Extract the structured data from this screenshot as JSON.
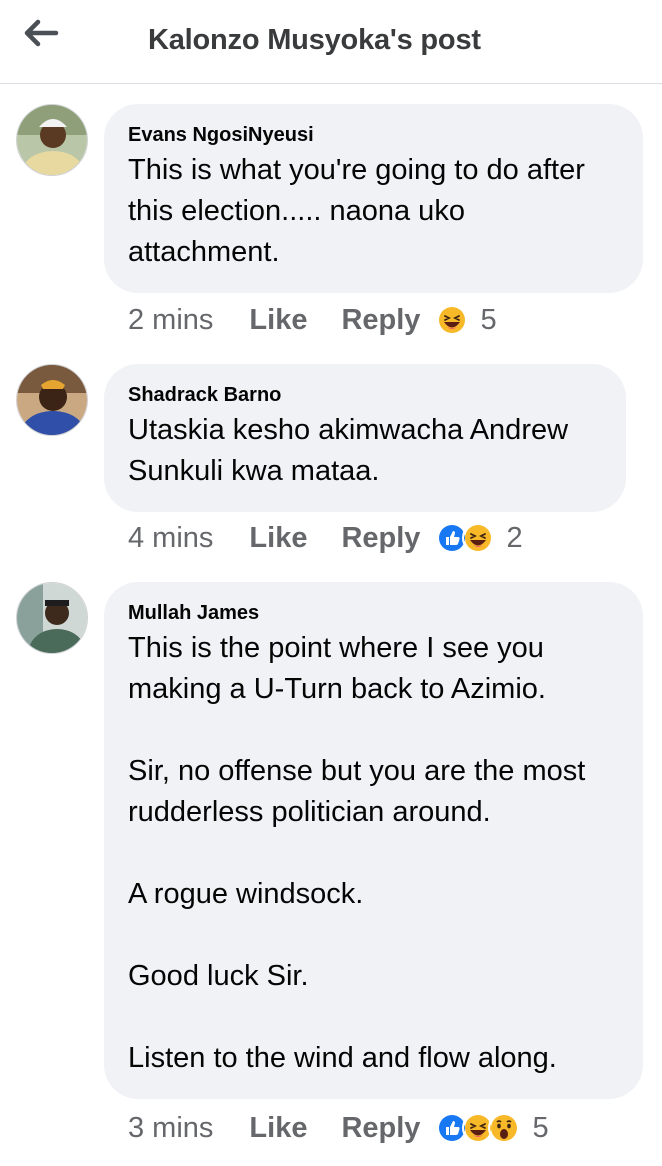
{
  "header": {
    "title": "Kalonzo Musyoka's post",
    "back_icon": "arrow-left-icon"
  },
  "comments": [
    {
      "author": "Evans NgosiNyeusi",
      "text": "This is what you're going to do after this election..... naona uko attachment.",
      "time": "2 mins",
      "like_label": "Like",
      "reply_label": "Reply",
      "reactions": [
        "haha-icon"
      ],
      "reaction_count": "5"
    },
    {
      "author": "Shadrack Barno",
      "text": "Utaskia kesho akimwacha Andrew Sunkuli kwa mataa.",
      "time": "4 mins",
      "like_label": "Like",
      "reply_label": "Reply",
      "reactions": [
        "like-icon",
        "haha-icon"
      ],
      "reaction_count": "2"
    },
    {
      "author": "Mullah James",
      "text": "This is the point where I see you making a U-Turn back to Azimio.\n\nSir, no offense but you are the most rudderless politician around.\n\nA rogue windsock.\n\nGood luck Sir.\n\nListen to the wind and flow along.",
      "time": "3 mins",
      "like_label": "Like",
      "reply_label": "Reply",
      "reactions": [
        "like-icon",
        "haha-icon",
        "wow-icon"
      ],
      "reaction_count": "5"
    }
  ],
  "colors": {
    "bubble": "#f0f2f5",
    "meta_text": "#65676b",
    "like_blue": "#1877f2",
    "emoji_yellow": "#f7b928"
  }
}
